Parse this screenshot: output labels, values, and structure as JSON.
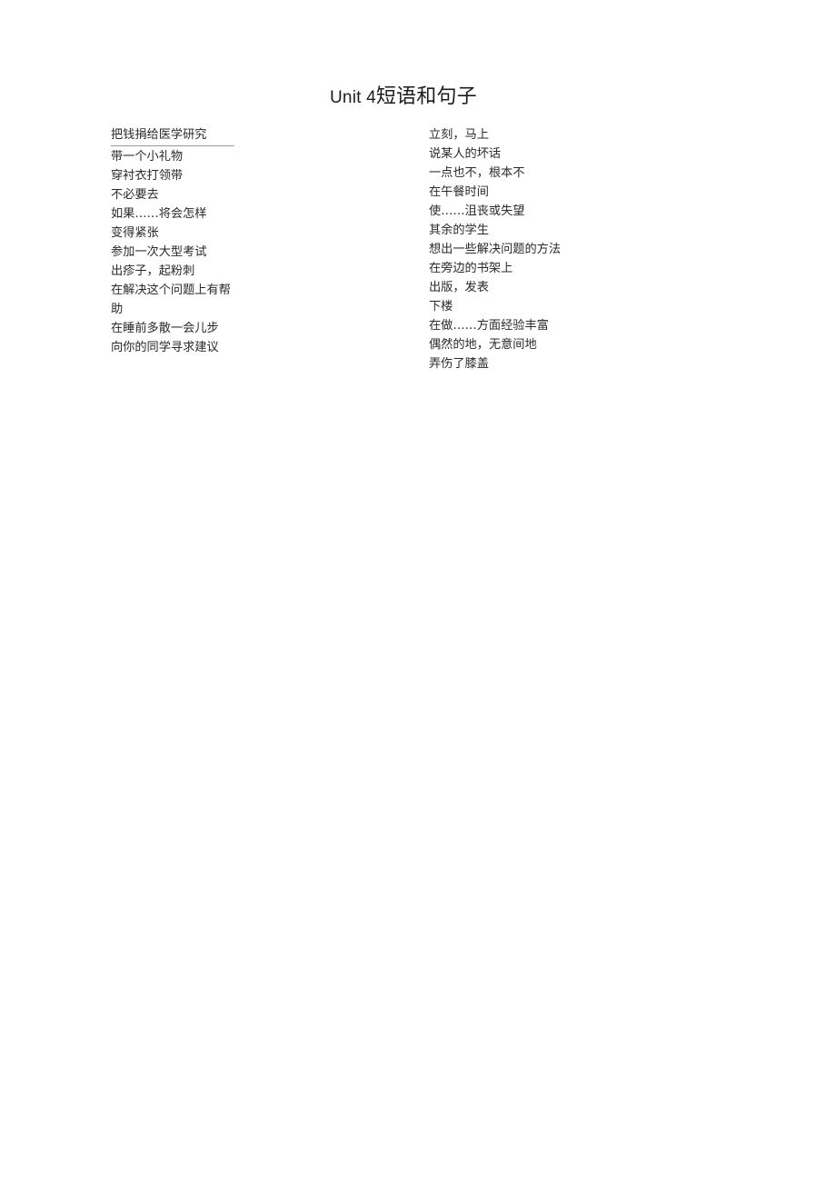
{
  "title": {
    "latin": "Unit 4",
    "han": "短语和句子",
    "full": "Unit 4 短语和句子"
  },
  "left_column": {
    "items": [
      "把钱捐给医学研究",
      "带一个小礼物",
      "穿衬衣打领带",
      "不必要去",
      "如果……将会怎样",
      "变得紧张",
      "参加一次大型考试",
      "出疹子，起粉刺",
      "在解决这个问题上有帮助",
      "在睡前多散一会儿步",
      "向你的同学寻求建议"
    ]
  },
  "right_column": {
    "items": [
      "立刻，马上",
      "说某人的坏话",
      "一点也不，根本不",
      "在午餐时间",
      "使……沮丧或失望",
      "其余的学生",
      "想出一些解决问题的方法",
      "在旁边的书架上",
      "出版，发表",
      "下楼",
      "在做……方面经验丰富",
      "偶然的地，无意间地",
      "弄伤了膝盖"
    ]
  },
  "colors": {
    "text": "#2a2a2a",
    "title": "#1c1c1c",
    "rule": "#9a9a9a",
    "background": "#ffffff"
  }
}
